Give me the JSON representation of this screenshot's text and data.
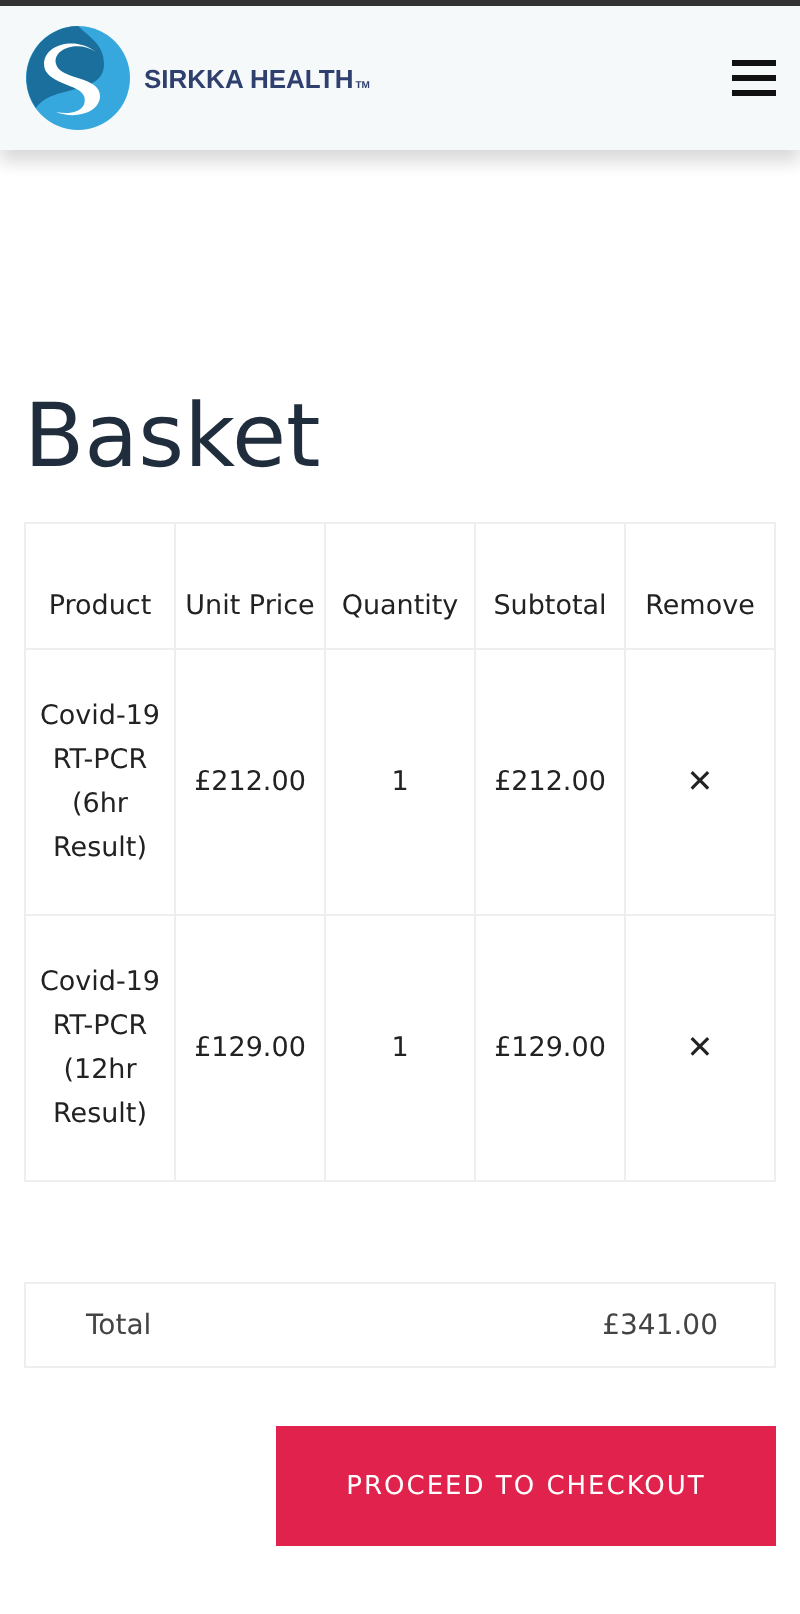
{
  "header": {
    "brand": "SIRKKA HEALTH",
    "trademark": "TM"
  },
  "page_title": "Basket",
  "table": {
    "columns": [
      "Product",
      "Unit Price",
      "Quantity",
      "Subtotal",
      "Remove"
    ],
    "rows": [
      {
        "product": "Covid-19 RT-PCR (6hr Result)",
        "unit_price": "£212.00",
        "quantity": "1",
        "subtotal": "£212.00",
        "remove": "✕"
      },
      {
        "product": "Covid-19 RT-PCR (12hr Result)",
        "unit_price": "£129.00",
        "quantity": "1",
        "subtotal": "£129.00",
        "remove": "✕"
      }
    ]
  },
  "total": {
    "label": "Total",
    "value": "£341.00"
  },
  "checkout_button": "PROCEED TO CHECKOUT"
}
